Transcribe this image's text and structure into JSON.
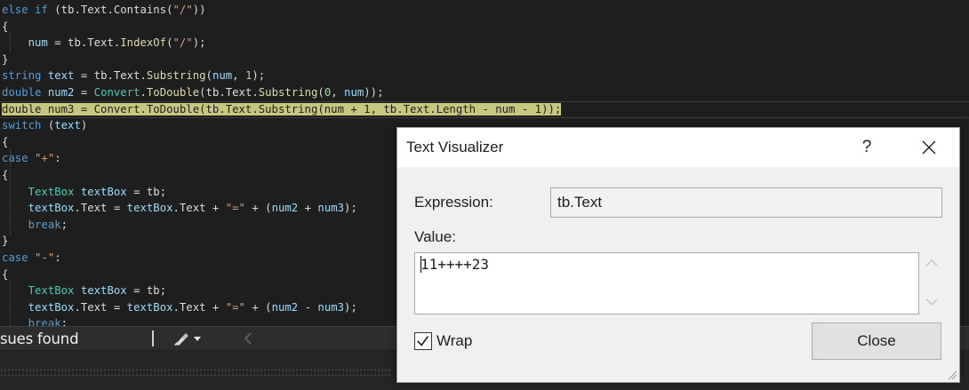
{
  "editor": {
    "lines": [
      [
        {
          "t": "else if ",
          "c": "kw"
        },
        {
          "t": "(tb.Text.",
          "c": "pl"
        },
        {
          "t": "Contains",
          "c": "pl"
        },
        {
          "t": "(",
          "c": "pl"
        },
        {
          "t": "\"/\"",
          "c": "str"
        },
        {
          "t": "))",
          "c": "pl"
        }
      ],
      [
        {
          "t": "{",
          "c": "pl"
        }
      ],
      [
        {
          "t": "    num",
          "c": "var"
        },
        {
          "t": " = tb.Text.",
          "c": "pl"
        },
        {
          "t": "IndexOf",
          "c": "meth"
        },
        {
          "t": "(",
          "c": "pl"
        },
        {
          "t": "\"/\"",
          "c": "str"
        },
        {
          "t": ");",
          "c": "pl"
        }
      ],
      [
        {
          "t": "}",
          "c": "pl"
        }
      ],
      [
        {
          "t": "string ",
          "c": "kw"
        },
        {
          "t": "text",
          "c": "var"
        },
        {
          "t": " = tb.Text.",
          "c": "pl"
        },
        {
          "t": "Substring",
          "c": "meth"
        },
        {
          "t": "(",
          "c": "pl"
        },
        {
          "t": "num",
          "c": "var"
        },
        {
          "t": ", ",
          "c": "pl"
        },
        {
          "t": "1",
          "c": "num"
        },
        {
          "t": ");",
          "c": "pl"
        }
      ],
      [
        {
          "t": "double ",
          "c": "kw"
        },
        {
          "t": "num2",
          "c": "var"
        },
        {
          "t": " = ",
          "c": "pl"
        },
        {
          "t": "Convert",
          "c": "tp"
        },
        {
          "t": ".",
          "c": "pl"
        },
        {
          "t": "ToDouble",
          "c": "meth"
        },
        {
          "t": "(tb.Text.",
          "c": "pl"
        },
        {
          "t": "Substring",
          "c": "meth"
        },
        {
          "t": "(",
          "c": "pl"
        },
        {
          "t": "0",
          "c": "num"
        },
        {
          "t": ", ",
          "c": "pl"
        },
        {
          "t": "num",
          "c": "var"
        },
        {
          "t": "));",
          "c": "pl"
        }
      ],
      [
        {
          "t": "double num3 = Convert.ToDouble(tb.Text.Substring(num + 1, tb.Text.Length - num - 1));",
          "c": "hl-text"
        }
      ],
      [
        {
          "t": "switch ",
          "c": "kw"
        },
        {
          "t": "(",
          "c": "pl"
        },
        {
          "t": "text",
          "c": "var"
        },
        {
          "t": ")",
          "c": "pl"
        }
      ],
      [
        {
          "t": "{",
          "c": "pl"
        }
      ],
      [
        {
          "t": "case ",
          "c": "kw"
        },
        {
          "t": "\"+\"",
          "c": "str"
        },
        {
          "t": ":",
          "c": "pl"
        }
      ],
      [
        {
          "t": "{",
          "c": "pl"
        }
      ],
      [
        {
          "t": "    TextBox ",
          "c": "tp"
        },
        {
          "t": "textBox",
          "c": "var"
        },
        {
          "t": " = tb;",
          "c": "pl"
        }
      ],
      [
        {
          "t": "    textBox",
          "c": "var"
        },
        {
          "t": ".Text = ",
          "c": "pl"
        },
        {
          "t": "textBox",
          "c": "var"
        },
        {
          "t": ".Text + ",
          "c": "pl"
        },
        {
          "t": "\"=\"",
          "c": "str"
        },
        {
          "t": " + (",
          "c": "pl"
        },
        {
          "t": "num2",
          "c": "var"
        },
        {
          "t": " + ",
          "c": "pl"
        },
        {
          "t": "num3",
          "c": "var"
        },
        {
          "t": ");",
          "c": "pl"
        }
      ],
      [
        {
          "t": "    break",
          "c": "kw"
        },
        {
          "t": ";",
          "c": "pl"
        }
      ],
      [
        {
          "t": "}",
          "c": "pl"
        }
      ],
      [
        {
          "t": "case ",
          "c": "kw"
        },
        {
          "t": "\"-\"",
          "c": "str"
        },
        {
          "t": ":",
          "c": "pl"
        }
      ],
      [
        {
          "t": "{",
          "c": "pl"
        }
      ],
      [
        {
          "t": "    TextBox ",
          "c": "tp"
        },
        {
          "t": "textBox",
          "c": "var"
        },
        {
          "t": " = tb;",
          "c": "pl"
        }
      ],
      [
        {
          "t": "    textBox",
          "c": "var"
        },
        {
          "t": ".Text = ",
          "c": "pl"
        },
        {
          "t": "textBox",
          "c": "var"
        },
        {
          "t": ".Text + ",
          "c": "pl"
        },
        {
          "t": "\"=\"",
          "c": "str"
        },
        {
          "t": " + (",
          "c": "pl"
        },
        {
          "t": "num2",
          "c": "var"
        },
        {
          "t": " - ",
          "c": "pl"
        },
        {
          "t": "num3",
          "c": "var"
        },
        {
          "t": ");",
          "c": "pl"
        }
      ],
      [
        {
          "t": "    break",
          "c": "kw"
        },
        {
          "t": ";",
          "c": "pl"
        }
      ]
    ],
    "highlighted_line_index": 6
  },
  "status": {
    "issues_text": "sues found",
    "cleanup_icon": "brush-icon",
    "dropdown_icon": "chevron-down-icon",
    "nav_icon": "arrow-left-icon"
  },
  "dialog": {
    "title": "Text Visualizer",
    "help_label": "?",
    "close_icon": "close-icon",
    "expression_label": "Expression:",
    "expression_value": "tb.Text",
    "value_label": "Value:",
    "value_text": "11++++23",
    "wrap_label": "Wrap",
    "wrap_checked": true,
    "close_button": "Close"
  },
  "colors": {
    "editor_bg": "#1e1e1e",
    "keyword": "#569cd6",
    "type": "#4ec9b0",
    "string": "#d69d85",
    "number": "#b5cea8",
    "variable": "#9cdcfe",
    "method": "#dcdcaa",
    "highlight": "#c7c77f",
    "dialog_bg": "#f0f0f0"
  }
}
